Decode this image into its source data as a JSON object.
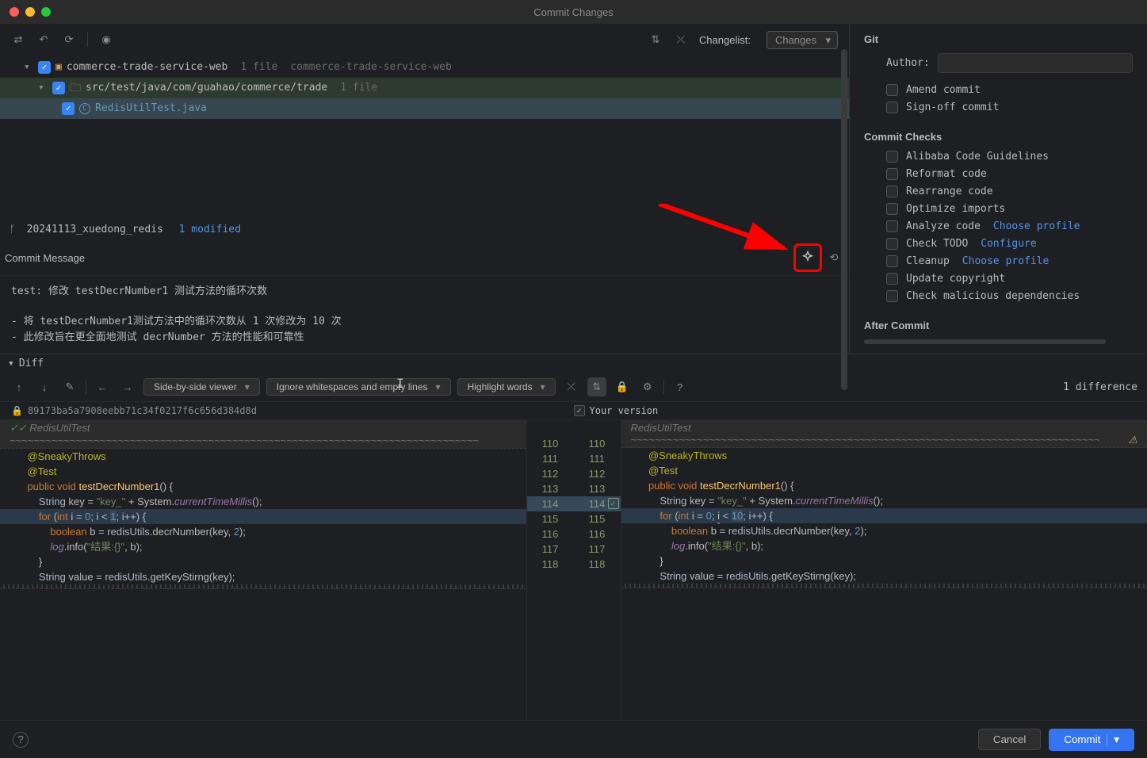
{
  "title": "Commit Changes",
  "toolbar": {
    "changelist_label": "Changelist:",
    "changelist_value": "Changes"
  },
  "tree": {
    "root": {
      "name": "commerce-trade-service-web",
      "count": "1 file",
      "module": "commerce-trade-service-web"
    },
    "folder": {
      "path": "src/test/java/com/guahao/commerce/trade",
      "count": "1 file"
    },
    "file": {
      "name": "RedisUtilTest.java"
    }
  },
  "branch": {
    "name": "20241113_xuedong_redis",
    "status": "1 modified"
  },
  "commit_message": {
    "label": "Commit Message",
    "line1": "test: 修改 testDecrNumber1 测试方法的循环次数",
    "line2": "- 将 testDecrNumber1测试方法中的循环次数从 1 次修改为 10 次",
    "line3": "- 此修改旨在更全面地测试 decrNumber 方法的性能和可靠性"
  },
  "git_panel": {
    "title": "Git",
    "author_label": "Author:",
    "amend": "Amend commit",
    "signoff": "Sign-off commit",
    "checks_title": "Commit Checks",
    "checks": {
      "alibaba": "Alibaba Code Guidelines",
      "reformat": "Reformat code",
      "rearrange": "Rearrange code",
      "optimize": "Optimize imports",
      "analyze": "Analyze code",
      "analyze_link": "Choose profile",
      "todo": "Check TODO",
      "todo_link": "Configure",
      "cleanup": "Cleanup",
      "cleanup_link": "Choose profile",
      "copyright": "Update copyright",
      "malicious": "Check malicious dependencies"
    },
    "after_commit": "After Commit"
  },
  "diff": {
    "header": "Diff",
    "view_mode": "Side-by-side viewer",
    "whitespace": "Ignore whitespaces and empty lines",
    "highlight": "Highlight words",
    "count": "1 difference",
    "left_hash": "89173ba5a7908eebb71c34f0217f6c656d384d8d",
    "right_label": "Your version",
    "class_name": "RedisUtilTest",
    "lines_left": [
      "110",
      "111",
      "112",
      "113",
      "114",
      "115",
      "116",
      "117",
      "118"
    ],
    "lines_right": [
      "110",
      "111",
      "112",
      "113",
      "114",
      "115",
      "116",
      "117",
      "118"
    ],
    "left_loop_max": "1",
    "right_loop_max": "10"
  },
  "footer": {
    "cancel": "Cancel",
    "commit": "Commit"
  }
}
